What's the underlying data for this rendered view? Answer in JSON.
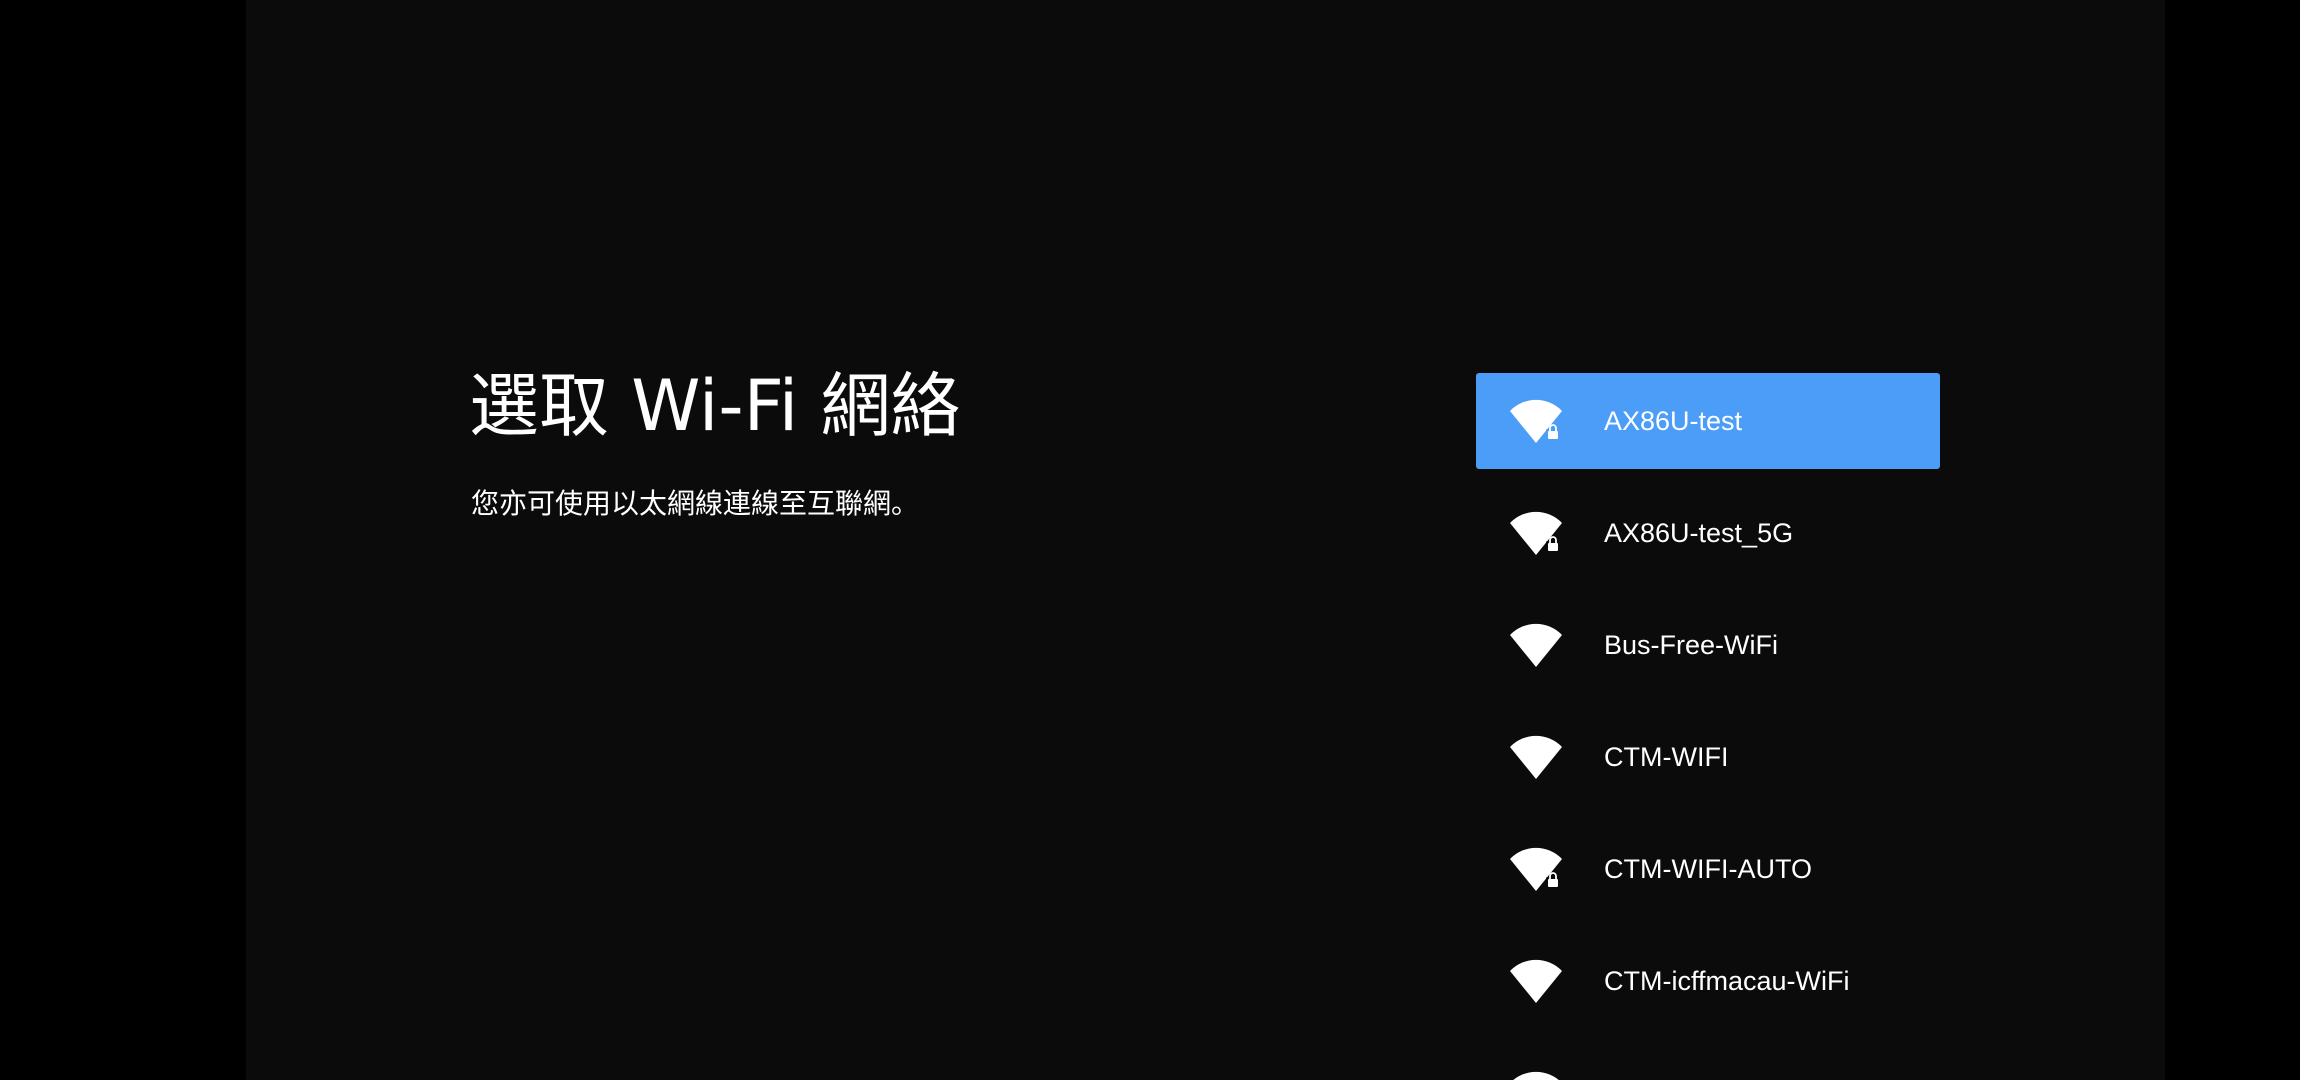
{
  "page": {
    "title": "選取 Wi-Fi 網絡",
    "subtitle": "您亦可使用以太網線連線至互聯網。"
  },
  "colors": {
    "background": "#0b0b0b",
    "letterbox": "#000000",
    "selected": "#4c9df8",
    "text": "#ffffff"
  },
  "networks": [
    {
      "ssid": "AX86U-test",
      "secured": true,
      "selected": true,
      "icon": "wifi-lock-icon"
    },
    {
      "ssid": "AX86U-test_5G",
      "secured": true,
      "selected": false,
      "icon": "wifi-lock-icon"
    },
    {
      "ssid": "Bus-Free-WiFi",
      "secured": false,
      "selected": false,
      "icon": "wifi-icon"
    },
    {
      "ssid": "CTM-WIFI",
      "secured": false,
      "selected": false,
      "icon": "wifi-icon"
    },
    {
      "ssid": "CTM-WIFI-AUTO",
      "secured": true,
      "selected": false,
      "icon": "wifi-lock-icon"
    },
    {
      "ssid": "CTM-icffmacau-WiFi",
      "secured": false,
      "selected": false,
      "icon": "wifi-icon"
    },
    {
      "ssid": "",
      "secured": false,
      "selected": false,
      "icon": "wifi-icon"
    }
  ]
}
